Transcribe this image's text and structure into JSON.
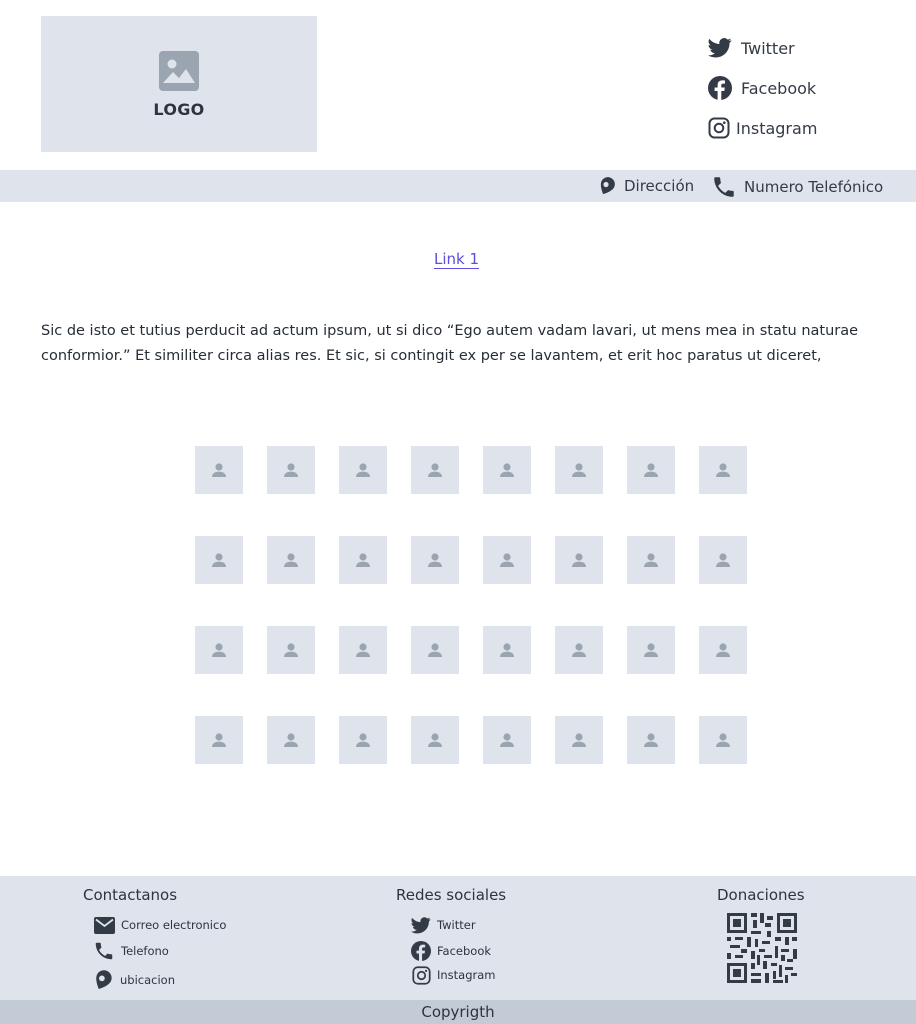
{
  "header": {
    "logo_text": "LOGO",
    "social": [
      {
        "label": "Twitter",
        "icon": "twitter-icon"
      },
      {
        "label": "Facebook",
        "icon": "facebook-icon"
      },
      {
        "label": "Instagram",
        "icon": "instagram-icon"
      }
    ]
  },
  "info_bar": {
    "address_label": "Dirección",
    "phone_label": "Numero Telefónico"
  },
  "main": {
    "link_label": "Link 1",
    "paragraph": "Sic de isto et tutius perducit ad actum ipsum, ut si dico “Ego autem vadam lavari, ut mens mea in statu naturae conformior.” Et similiter circa alias res. Et sic, si contingit ex per se lavantem, et erit hoc paratus ut diceret,"
  },
  "gallery": {
    "rows": 4,
    "columns": 8,
    "icon": "user-icon"
  },
  "footer": {
    "contact": {
      "title": "Contactanos",
      "items": [
        {
          "label": "Correo electronico",
          "icon": "mail-icon"
        },
        {
          "label": "Telefono",
          "icon": "phone-icon"
        },
        {
          "label": "ubicacion",
          "icon": "location-icon"
        }
      ]
    },
    "social": {
      "title": "Redes sociales",
      "items": [
        {
          "label": "Twitter",
          "icon": "twitter-icon"
        },
        {
          "label": "Facebook",
          "icon": "facebook-icon"
        },
        {
          "label": "Instagram",
          "icon": "instagram-icon"
        }
      ]
    },
    "donations": {
      "title": "Donaciones",
      "icon": "qr-code-icon"
    },
    "copyright": "Copyrigth"
  },
  "colors": {
    "placeholder_bg": "#dfe4ec",
    "icon_gray": "#9aa5b1",
    "link": "#5b4ee0",
    "text": "#333b47",
    "copyright_bar": "#c3ccd6"
  }
}
